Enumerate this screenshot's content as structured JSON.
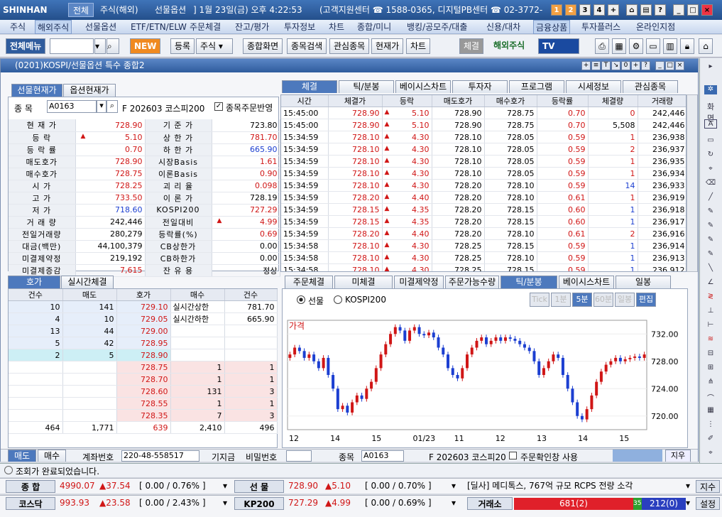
{
  "app": {
    "logo": "SHINHAN",
    "tab_all": "전체",
    "tab_overseas": "주식(해외)",
    "tab_futures": "선물옵션",
    "datetime": "]  1월 23일(금) 오후 4:22:53",
    "support": "(고객지원센터 ☎ 1588-0365, 디지털PB센터 ☎ 02-3772-",
    "nums": [
      "1",
      "2",
      "3",
      "4",
      "+"
    ]
  },
  "menu": [
    "주식",
    "해외주식",
    "선물옵션",
    "ETF/ETN/ELW",
    "주문체결",
    "잔고/평가",
    "투자정보",
    "차트",
    "종합/미니",
    "뱅킹/공모주/대출",
    "신용/대차",
    "금융상품",
    "투자플러스",
    "온라인지점"
  ],
  "toolbar": {
    "all_menu": "전체메뉴",
    "new": "NEW",
    "register": "등록",
    "stock": "주식",
    "combo": "종합화면",
    "search": "종목검색",
    "watch": "관심종목",
    "price": "현재가",
    "chart": "차트",
    "trade": "체결",
    "overseas": "해외주식",
    "tv": "TV"
  },
  "window": {
    "title": "(0201)KOSPI/선물옵션 특수 종합2",
    "btns": [
      "+",
      "≡",
      "T",
      "↘",
      "0",
      "+",
      "?",
      "_",
      "□",
      "×"
    ]
  },
  "left": {
    "tabs": [
      "선물현재가",
      "옵션현재가"
    ],
    "code_label": "종   목",
    "code": "A0163",
    "name": "F 202603 코스피200",
    "reflect": "종목주문반영",
    "rows": [
      {
        "l": "현 재 가",
        "v": "728.90",
        "vc": "red",
        "l2": "기 준 가",
        "v2": "723.80",
        "v2c": "bk"
      },
      {
        "l": "등    락",
        "v": "5.10",
        "vc": "red",
        "up": "▲",
        "l2": "상 한 가",
        "v2": "781.70",
        "v2c": "red"
      },
      {
        "l": "등 락 률",
        "v": "0.70",
        "vc": "red",
        "l2": "하 한 가",
        "v2": "665.90",
        "v2c": "blue"
      },
      {
        "l": "매도호가",
        "v": "728.90",
        "vc": "red",
        "l2": "시장Basis",
        "v2": "1.61",
        "v2c": "red"
      },
      {
        "l": "매수호가",
        "v": "728.75",
        "vc": "red",
        "l2": "이론Basis",
        "v2": "0.90",
        "v2c": "red"
      },
      {
        "l": "시    가",
        "v": "728.25",
        "vc": "red",
        "l2": "괴 리 율",
        "v2": "0.098",
        "v2c": "red"
      },
      {
        "l": "고    가",
        "v": "733.50",
        "vc": "red",
        "l2": "이 론 가",
        "v2": "728.19",
        "v2c": "bk"
      },
      {
        "l": "저    가",
        "v": "718.60",
        "vc": "blue",
        "l2": "KOSPI200",
        "v2": "727.29",
        "v2c": "red"
      },
      {
        "l": "거 래 량",
        "v": "242,446",
        "vc": "bk",
        "l2": "전일대비",
        "v2": "4.99",
        "v2c": "red",
        "up2": "▲"
      },
      {
        "l": "전일거래량",
        "v": "280,279",
        "vc": "bk",
        "l2": "등락률(%)",
        "v2": "0.69",
        "v2c": "red"
      },
      {
        "l": "대금(백만)",
        "v": "44,100,379",
        "vc": "bk",
        "l2": "CB상한가",
        "v2": "0.00",
        "v2c": "bk"
      },
      {
        "l": "미결제약정",
        "v": "219,192",
        "vc": "bk",
        "l2": "CB하한가",
        "v2": "0.00",
        "v2c": "bk"
      },
      {
        "l": "미결제증감",
        "v": "7,615",
        "vc": "red",
        "l2": "잔 유 용",
        "v2": "정상",
        "v2c": "bk"
      }
    ]
  },
  "trades": {
    "tabs": [
      "체결",
      "틱/분봉",
      "베이시스차트",
      "투자자",
      "프로그램",
      "시세정보",
      "관심종목"
    ],
    "headers": [
      "시간",
      "체결가",
      "등락",
      "매도호가",
      "매수호가",
      "등락률",
      "체결량",
      "거래량"
    ],
    "rows": [
      [
        "15:45:00",
        "728.90",
        "5.10",
        "728.90",
        "728.75",
        "0.70",
        "0",
        "242,446",
        "red"
      ],
      [
        "15:45:00",
        "728.90",
        "5.10",
        "728.90",
        "728.75",
        "0.70",
        "5,508",
        "242,446",
        "bk"
      ],
      [
        "15:34:59",
        "728.10",
        "4.30",
        "728.10",
        "728.05",
        "0.59",
        "1",
        "236,938",
        "red"
      ],
      [
        "15:34:59",
        "728.10",
        "4.30",
        "728.10",
        "728.05",
        "0.59",
        "2",
        "236,937",
        "red"
      ],
      [
        "15:34:59",
        "728.10",
        "4.30",
        "728.10",
        "728.05",
        "0.59",
        "1",
        "236,935",
        "red"
      ],
      [
        "15:34:59",
        "728.10",
        "4.30",
        "728.10",
        "728.05",
        "0.59",
        "1",
        "236,934",
        "red"
      ],
      [
        "15:34:59",
        "728.10",
        "4.30",
        "728.20",
        "728.10",
        "0.59",
        "14",
        "236,933",
        "blue"
      ],
      [
        "15:34:59",
        "728.20",
        "4.40",
        "728.20",
        "728.10",
        "0.61",
        "1",
        "236,919",
        "red"
      ],
      [
        "15:34:59",
        "728.15",
        "4.35",
        "728.20",
        "728.15",
        "0.60",
        "1",
        "236,918",
        "blue"
      ],
      [
        "15:34:59",
        "728.15",
        "4.35",
        "728.20",
        "728.15",
        "0.60",
        "1",
        "236,917",
        "blue"
      ],
      [
        "15:34:59",
        "728.20",
        "4.40",
        "728.20",
        "728.10",
        "0.61",
        "2",
        "236,916",
        "red"
      ],
      [
        "15:34:58",
        "728.10",
        "4.30",
        "728.25",
        "728.15",
        "0.59",
        "1",
        "236,914",
        "blue"
      ],
      [
        "15:34:58",
        "728.10",
        "4.30",
        "728.25",
        "728.10",
        "0.59",
        "1",
        "236,913",
        "blue"
      ],
      [
        "15:34:58",
        "728.10",
        "4.30",
        "728.25",
        "728.15",
        "0.59",
        "1",
        "236,912",
        "blue"
      ]
    ]
  },
  "orderbook": {
    "tabs": [
      "호가",
      "실시간체결"
    ],
    "headers": [
      "건수",
      "매도",
      "호가",
      "매수",
      "건수"
    ],
    "asks": [
      [
        "10",
        "141",
        "729.10"
      ],
      [
        "4",
        "10",
        "729.05"
      ],
      [
        "13",
        "44",
        "729.00"
      ],
      [
        "5",
        "42",
        "728.95"
      ],
      [
        "2",
        "5",
        "728.90"
      ]
    ],
    "bids": [
      [
        "728.75",
        "1",
        "1"
      ],
      [
        "728.70",
        "1",
        "1"
      ],
      [
        "728.60",
        "131",
        "3"
      ],
      [
        "728.55",
        "1",
        "1"
      ],
      [
        "728.35",
        "7",
        "3"
      ]
    ],
    "upper_label": "실시간상한",
    "upper": "781.70",
    "lower_label": "실시간하한",
    "lower": "665.90",
    "tot": [
      "464",
      "1,771",
      "639",
      "2,410",
      "496"
    ]
  },
  "chartpanel": {
    "tabs": [
      "주문체결",
      "미체결",
      "미결제약정",
      "주문가능수량",
      "틱/분봉",
      "베이시스차트",
      "일봉"
    ],
    "radio1": "선물",
    "radio2": "KOSPI200",
    "period": [
      "Tick",
      "1분",
      "5분",
      "60분",
      "일봉",
      "편집"
    ],
    "label": "가격"
  },
  "chart_data": {
    "type": "candlestick",
    "ylabel": "가격",
    "yticks": [
      "732.00",
      "728.00",
      "724.00",
      "720.00"
    ],
    "ylim": [
      718.0,
      734.0
    ],
    "xticks": [
      "12",
      "14",
      "15",
      "01/23",
      "11",
      "12",
      "13",
      "14",
      "15"
    ],
    "closes": [
      729,
      730,
      729.5,
      728.5,
      729,
      728,
      727,
      728.5,
      726,
      724,
      721,
      721.5,
      720.5,
      722,
      723,
      722.5,
      724,
      725,
      727,
      729,
      730.5,
      732,
      733,
      732.5,
      731,
      732.5,
      733,
      732,
      731.8,
      732.2,
      731.5,
      730,
      729,
      727,
      726,
      725.5,
      727,
      729,
      730,
      731,
      731.5,
      730.5,
      731,
      731.5,
      731,
      731.5,
      731.3,
      731,
      730.5,
      730,
      729.5,
      728,
      726,
      727,
      728,
      729,
      728.5,
      726,
      724,
      722,
      720,
      719.5,
      721,
      723,
      725,
      726.5,
      727.5,
      728,
      728.5,
      728,
      728.3,
      728.5,
      728.7,
      728.5,
      729
    ],
    "opens": [
      728.5,
      729,
      730,
      729.5,
      728.5,
      729,
      728,
      727,
      728.5,
      726,
      724,
      721,
      721.5,
      720.5,
      722,
      723,
      722.5,
      724,
      725,
      727,
      729,
      730.5,
      732,
      733,
      732.5,
      731,
      732.5,
      733,
      732,
      731.8,
      732.2,
      731.5,
      730,
      729,
      727,
      726,
      725.5,
      727,
      729,
      730,
      731,
      731.5,
      730.5,
      731,
      731.5,
      731,
      731.5,
      731.3,
      731,
      730.5,
      730,
      729.5,
      728,
      726,
      727,
      728,
      729,
      728.5,
      726,
      724,
      722,
      720,
      719.5,
      721,
      723,
      725,
      726.5,
      727.5,
      728,
      728.5,
      728,
      728.3,
      728.5,
      728.7,
      728.5
    ]
  },
  "bottomform": {
    "sell": "매도",
    "buy": "매수",
    "acct_label": "계좌번호",
    "acct": "220-48-558517",
    "trade_label": "기지금",
    "pw_label": "비밀번호",
    "code_label": "종목",
    "code": "A0163",
    "name": "F 202603 코스피20",
    "confirm": "주문확인창 사용",
    "send": "지우"
  },
  "status": {
    "msg": "조회가 완료되었습니다."
  },
  "ticker1": {
    "l1": "종  합",
    "v1": "4990.07",
    "c1": "▲37.54",
    "b1": "[ 0.00  /  0.76% ]",
    "l2": "선  물",
    "v2": "728.90",
    "c2": "▲5.10",
    "b2": "[ 0.00  /  0.70% ]",
    "news": "[딜사] 메디톡스, 767억 규모 RCPS 전량 소각",
    "btn": "지수"
  },
  "ticker2": {
    "l1": "코스닥",
    "v1": "993.93",
    "c1": "▲23.58",
    "b1": "[ 0.00  /  2.43% ]",
    "l2": "KP200",
    "v2": "727.29",
    "c2": "▲4.99",
    "b2": "[ 0.00  /  0.69% ]",
    "l3": "거래소",
    "red": "681(2)",
    "mid": "35",
    "blue": "212(0)",
    "btn": "설정"
  },
  "colors": {
    "up": "#d01616",
    "down": "#1c3fd1",
    "accent": "#4d79bd"
  }
}
